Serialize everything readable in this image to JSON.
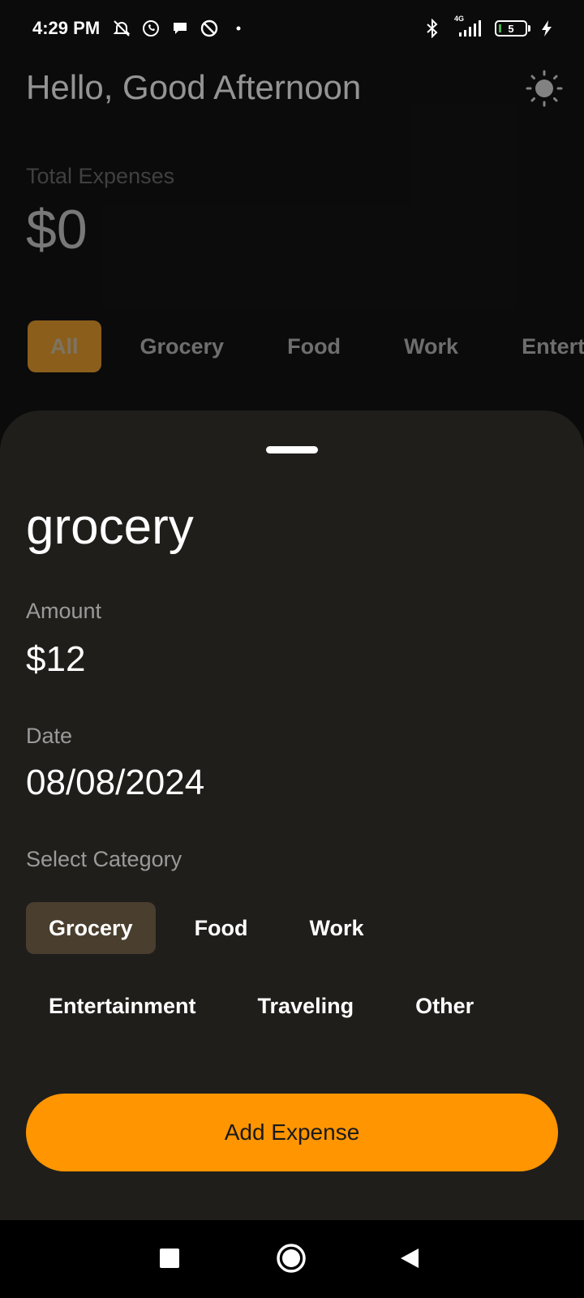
{
  "status_bar": {
    "time": "4:29 PM",
    "left_icons": [
      "mute-bell-icon",
      "whatsapp-icon",
      "chat-bubble-icon",
      "no-disturb-icon",
      "dot-icon"
    ],
    "network_label": "4G",
    "battery_level": "5",
    "colors": {
      "battery_low": "#4caf50"
    }
  },
  "header": {
    "greeting": "Hello, Good Afternoon",
    "theme_icon": "sun-icon"
  },
  "summary": {
    "total_label": "Total Expenses",
    "total_value": "$0"
  },
  "filters": {
    "items": [
      {
        "label": "All",
        "active": true
      },
      {
        "label": "Grocery",
        "active": false
      },
      {
        "label": "Food",
        "active": false
      },
      {
        "label": "Work",
        "active": false
      },
      {
        "label": "Entertainment",
        "active": false
      }
    ]
  },
  "sheet": {
    "title": "grocery",
    "amount_label": "Amount",
    "amount_value": "$12",
    "date_label": "Date",
    "date_value": "08/08/2024",
    "category_label": "Select Category",
    "categories": [
      {
        "label": "Grocery",
        "selected": true
      },
      {
        "label": "Food",
        "selected": false
      },
      {
        "label": "Work",
        "selected": false
      },
      {
        "label": "Entertainment",
        "selected": false
      },
      {
        "label": "Traveling",
        "selected": false
      },
      {
        "label": "Other",
        "selected": false
      }
    ],
    "submit_label": "Add Expense"
  },
  "nav": {
    "icons": [
      "recent-apps-icon",
      "home-icon",
      "back-icon"
    ]
  },
  "colors": {
    "accent": "#ff9500",
    "sheet_bg": "#1f1e1b",
    "selected_chip": "#4a3e2e"
  }
}
